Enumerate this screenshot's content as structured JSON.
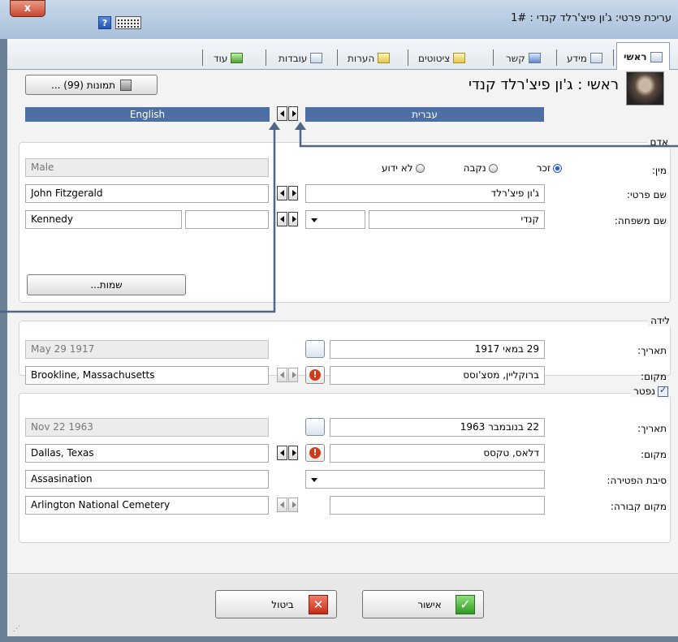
{
  "window": {
    "title": "עריכת פרטי: ג'ון פיצ'רלד קנדי : 1#",
    "close_label": "x",
    "help_label": "?"
  },
  "tabs": [
    {
      "label": "ראשי",
      "icon": "main-tab-icon",
      "active": true
    },
    {
      "label": "מידע",
      "icon": "info-icon"
    },
    {
      "label": "קשר",
      "icon": "home-icon"
    },
    {
      "label": "ציטוטים",
      "icon": "quotes-icon"
    },
    {
      "label": "הערות",
      "icon": "notes-icon"
    },
    {
      "label": "עובדות",
      "icon": "facts-icon"
    },
    {
      "label": "עוד",
      "icon": "add-icon"
    }
  ],
  "header": {
    "person_title": "ראשי : ג'ון פיצ'רלד קנדי",
    "photos_button": "תמונות (99) ..."
  },
  "languages": {
    "left": "English",
    "right": "עברית"
  },
  "person": {
    "section": "אדם",
    "gender_label": "מין:",
    "gender_options": [
      "זכר",
      "נקבה",
      "לא ידוע"
    ],
    "gender_selected": "זכר",
    "gender_en": "Male",
    "given_label": "שם פרטי:",
    "given_he": "ג'ון פיצ'רלד",
    "given_en": "John Fitzgerald",
    "surname_label": "שם משפחה:",
    "surname_he": "קנדי",
    "surname_en": "Kennedy",
    "names_button": "שמות..."
  },
  "birth": {
    "section": "לידה",
    "date_label": "תאריך:",
    "date_he": "29 במאי 1917",
    "date_en": "May 29 1917",
    "place_label": "מקום:",
    "place_he": "ברוקליין, מסצ'וסס",
    "place_en": "Brookline, Massachusetts"
  },
  "death": {
    "section": "נפטר",
    "checked": true,
    "date_label": "תאריך:",
    "date_he": "22 בנובמבר 1963",
    "date_en": "Nov 22 1963",
    "place_label": "מקום:",
    "place_he": "דלאס, טקסס",
    "place_en": "Dallas, Texas",
    "cause_label": "סיבת הפטירה:",
    "cause_en": "Assasination",
    "burial_label": "מקום קבורה:",
    "burial_en": "Arlington National Cemetery"
  },
  "footer": {
    "ok": "אישור",
    "cancel": "ביטול"
  },
  "colors": {
    "lang_bar": "#4e6fa3",
    "arrow": "#4f6684"
  }
}
